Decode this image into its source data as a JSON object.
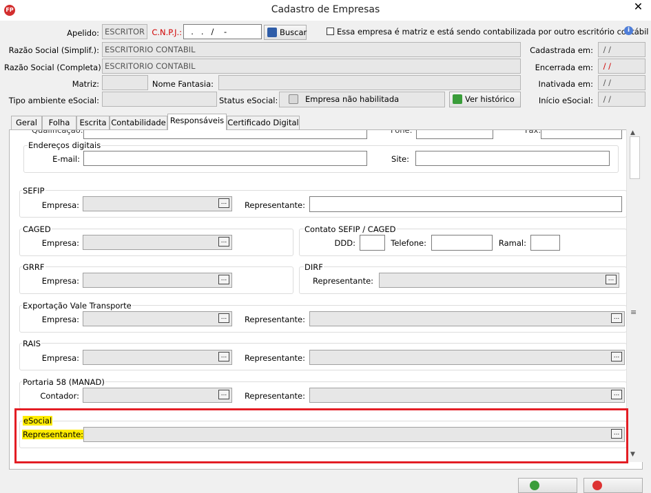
{
  "window": {
    "title": "Cadastro de Empresas",
    "app_icon": "FP",
    "close": "✕"
  },
  "header": {
    "apelido_label": "Apelido:",
    "apelido_value": "ESCRITOR",
    "cnpj_label": "C.N.P.J.:",
    "cnpj_value": "  .   .   /    -",
    "buscar_label": "Buscar",
    "matriz_checkbox_label": "Essa empresa é matriz e está sendo contabilizada por outro escritório contábil",
    "info_icon": "i",
    "razao_simpl_label": "Razão Social (Simplif.):",
    "razao_simpl_value": "ESCRITORIO CONTABIL",
    "razao_comp_label": "Razão Social (Completa):",
    "razao_comp_value": "ESCRITORIO CONTABIL",
    "matriz_label": "Matriz:",
    "nome_fantasia_label": "Nome Fantasia:",
    "tipo_ambiente_label": "Tipo ambiente eSocial:",
    "status_esocial_label": "Status eSocial:",
    "status_esocial_value": "Empresa não habilitada",
    "ver_historico_label": "Ver histórico",
    "cadastrada_label": "Cadastrada em:",
    "cadastrada_value": " / /",
    "encerrada_label": "Encerrada em:",
    "encerrada_value": " / /",
    "inativada_label": "Inativada em:",
    "inativada_value": " / /",
    "inicio_label": "Início eSocial:",
    "inicio_value": " / /"
  },
  "tabs": [
    "Geral",
    "Folha",
    "Escrita",
    "Contabilidade",
    "Responsáveis",
    "Certificado Digital"
  ],
  "responsaveis": {
    "cut_qualificacao": "Qualificação:",
    "cut_fone": "Fone:",
    "cut_fax": "Fax:",
    "enderecos_title": "Endereços digitais",
    "email_label": "E-mail:",
    "site_label": "Site:",
    "sefip_title": "SEFIP",
    "caged_title": "CAGED",
    "contato_title": "Contato SEFIP / CAGED",
    "ddd_label": "DDD:",
    "telefone_label": "Telefone:",
    "ramal_label": "Ramal:",
    "grrf_title": "GRRF",
    "dirf_title": "DIRF",
    "vale_title": "Exportação Vale Transporte",
    "rais_title": "RAIS",
    "portaria_title": "Portaria 58 (MANAD)",
    "esocial_title": "eSocial",
    "empresa_label": "Empresa:",
    "representante_label": "Representante:",
    "contador_label": "Contador:",
    "dots": "..."
  },
  "scroll": {
    "up": "▲",
    "down": "▼",
    "grip": "≡"
  }
}
